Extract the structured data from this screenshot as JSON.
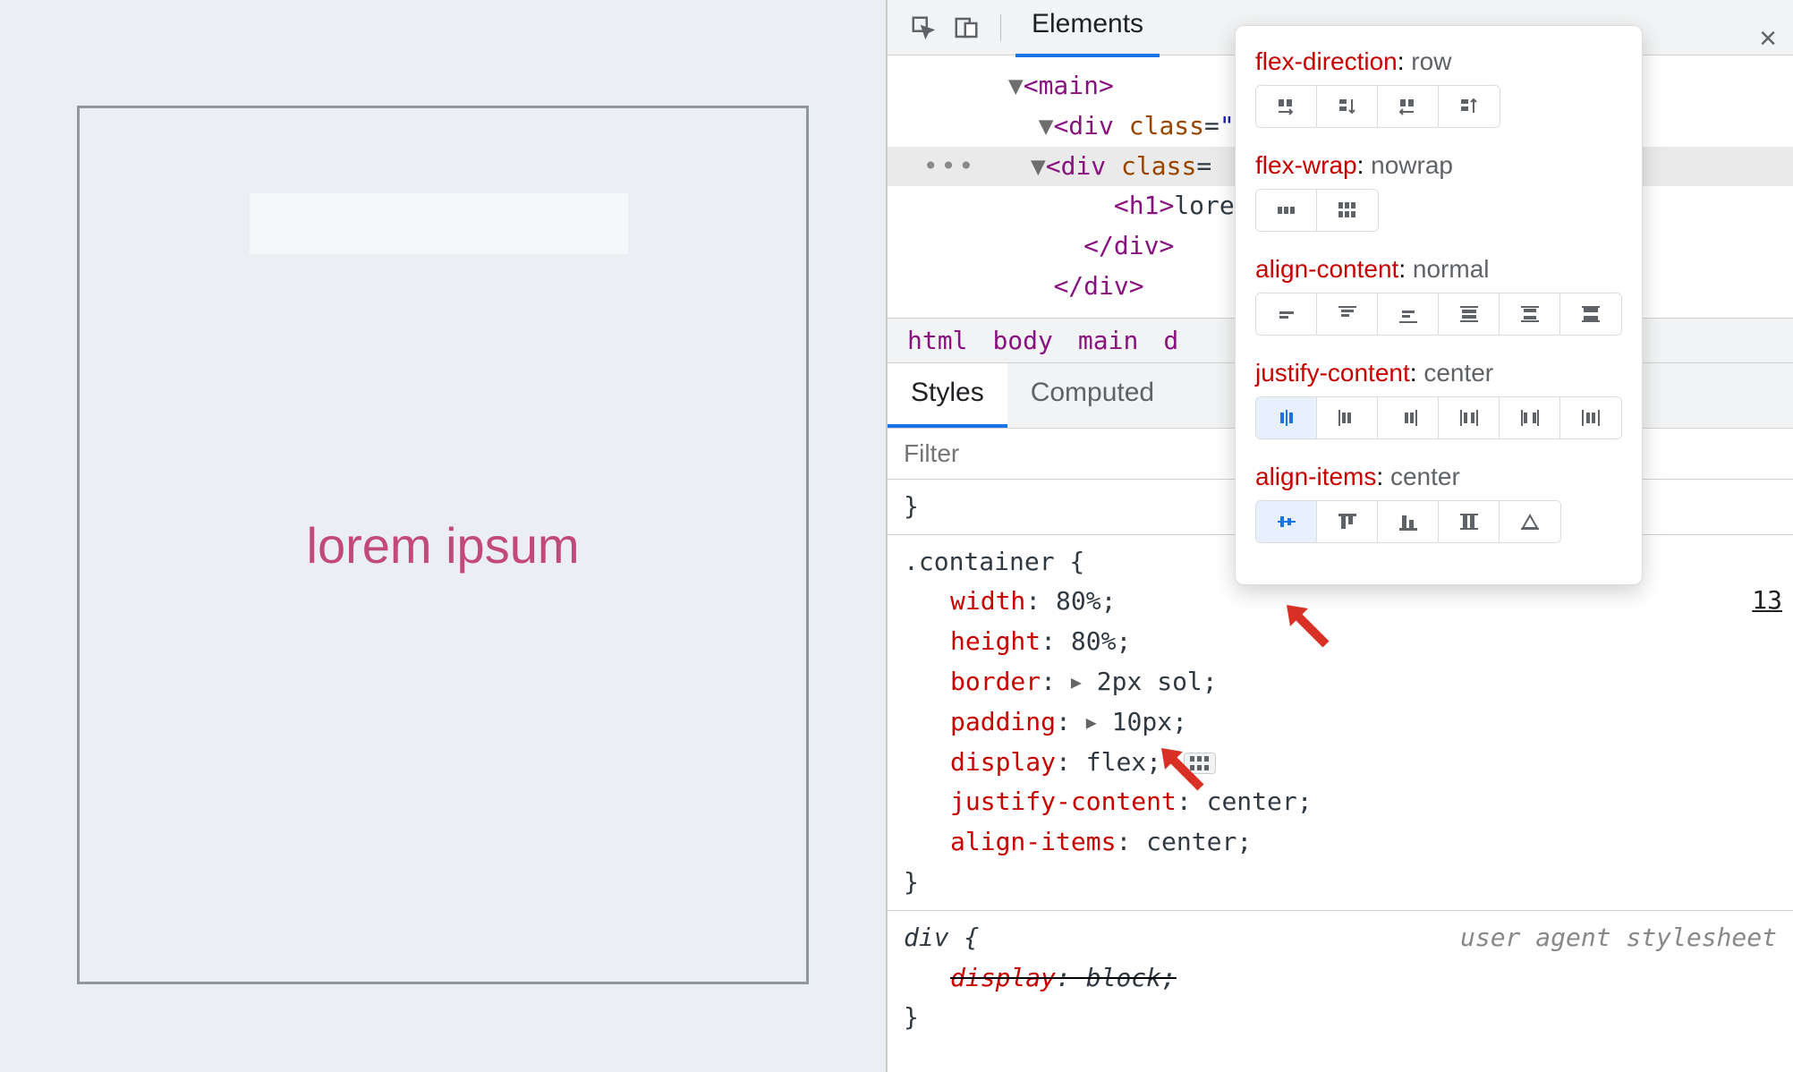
{
  "preview": {
    "heading": "lorem ipsum"
  },
  "devtools": {
    "tabs": {
      "elements": "Elements"
    },
    "close_label": "×",
    "dom": {
      "main": "<main>",
      "div_wrapper_open": "<div",
      "class_kw": "class",
      "eq": "=",
      "quote": "\"",
      "div_container_open": "<div",
      "h1_open": "<h1>",
      "h1_text": "lorem",
      "div_close": "</div>",
      "div_close2": "</div>"
    },
    "breadcrumb": [
      "html",
      "body",
      "main",
      "d"
    ],
    "styles_tabs": {
      "styles": "Styles",
      "computed": "Computed"
    },
    "filter_placeholder": "Filter",
    "rules": {
      "brace_close_top": "}",
      "container_selector": ".container {",
      "decls": [
        {
          "prop": "width",
          "val": "80%"
        },
        {
          "prop": "height",
          "val": "80%"
        },
        {
          "prop": "border",
          "val": "2px sol",
          "expand": true
        },
        {
          "prop": "padding",
          "val": "10px",
          "expand": true
        },
        {
          "prop": "display",
          "val": "flex",
          "flex_icon": true
        },
        {
          "prop": "justify-content",
          "val": "center"
        },
        {
          "prop": "align-items",
          "val": "center"
        }
      ],
      "brace": "}",
      "div_selector": "div {",
      "div_decl": {
        "prop": "display",
        "val": "block"
      },
      "ua_note": "user agent stylesheet",
      "side_link": "13"
    }
  },
  "popover": {
    "sections": [
      {
        "label": "flex-direction",
        "value": "row",
        "icons": 4,
        "selected": -1
      },
      {
        "label": "flex-wrap",
        "value": "nowrap",
        "icons": 2,
        "selected": -1
      },
      {
        "label": "align-content",
        "value": "normal",
        "icons": 6,
        "selected": -1
      },
      {
        "label": "justify-content",
        "value": "center",
        "icons": 6,
        "selected": 0
      },
      {
        "label": "align-items",
        "value": "center",
        "icons": 5,
        "selected": 0
      }
    ]
  }
}
